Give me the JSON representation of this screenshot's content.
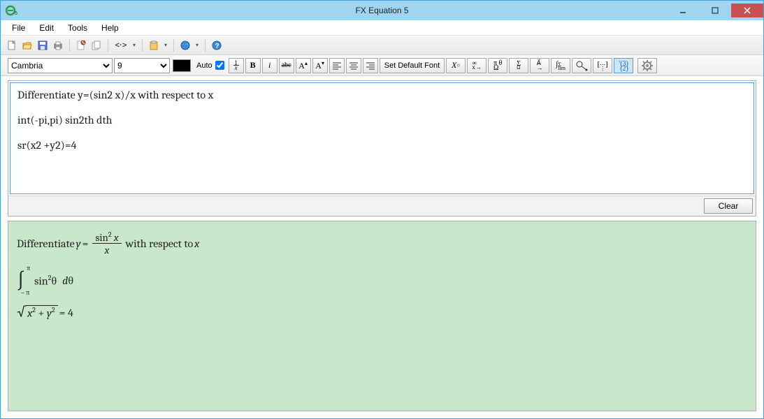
{
  "window": {
    "title": "FX Equation 5",
    "app_icon_label": "e5"
  },
  "menubar": [
    "File",
    "Edit",
    "Tools",
    "Help"
  ],
  "toolbar2": {
    "font_name": "Cambria",
    "font_size": "9",
    "auto_label": "Auto",
    "auto_checked": true,
    "set_default_label": "Set Default Font"
  },
  "input": {
    "line1": "Differentiate y=(sin2 x)/x with respect to x",
    "line2": "int(-pi,pi) sin2th dth",
    "line3": "sr(x2 +y2)=4",
    "clear_label": "Clear"
  },
  "preview": {
    "diff_prefix": "Differentiate ",
    "y_eq": "y",
    "equals": " = ",
    "sin": "sin",
    "sq": "2",
    "x": "x",
    "with_respect": " with respect to ",
    "x2": "x",
    "pi": "π",
    "negpi": "– π",
    "theta": "θ",
    "dth": "dθ",
    "plus": " + ",
    "y": "y",
    "eq4": " = 4"
  }
}
